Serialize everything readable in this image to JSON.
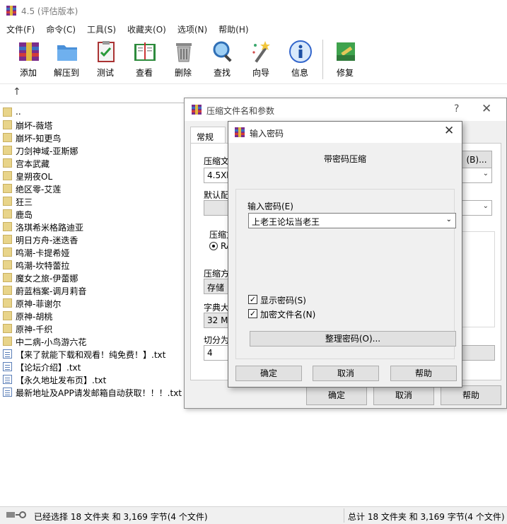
{
  "app": {
    "title": "4.5 (评估版本)"
  },
  "menu": [
    "文件(F)",
    "命令(C)",
    "工具(S)",
    "收藏夹(O)",
    "选项(N)",
    "帮助(H)"
  ],
  "toolbar": [
    {
      "label": "添加",
      "icon": "add-archive-icon"
    },
    {
      "label": "解压到",
      "icon": "extract-to-icon"
    },
    {
      "label": "测试",
      "icon": "test-icon"
    },
    {
      "label": "查看",
      "icon": "view-book-icon"
    },
    {
      "label": "删除",
      "icon": "delete-trash-icon"
    },
    {
      "label": "查找",
      "icon": "find-magnifier-icon"
    },
    {
      "label": "向导",
      "icon": "wizard-wand-icon"
    },
    {
      "label": "信息",
      "icon": "info-icon"
    },
    {
      "label": "修复",
      "icon": "repair-icon"
    }
  ],
  "address": {
    "up_symbol": "↑"
  },
  "files": [
    {
      "name": "..",
      "type": "folder"
    },
    {
      "name": "崩坏-薇塔",
      "type": "folder"
    },
    {
      "name": "崩坏-知更鸟",
      "type": "folder"
    },
    {
      "name": "刀剑神域-亚斯娜",
      "type": "folder"
    },
    {
      "name": "宫本武藏",
      "type": "folder"
    },
    {
      "name": "皇朔夜OL",
      "type": "folder"
    },
    {
      "name": "绝区零-艾莲",
      "type": "folder"
    },
    {
      "name": "狂三",
      "type": "folder"
    },
    {
      "name": "鹿岛",
      "type": "folder"
    },
    {
      "name": "洛琪希米格路迪亚",
      "type": "folder"
    },
    {
      "name": "明日方舟-迷迭香",
      "type": "folder"
    },
    {
      "name": "鸣潮-卡提希娅",
      "type": "folder"
    },
    {
      "name": "鸣潮-坎特蕾拉",
      "type": "folder"
    },
    {
      "name": "魔女之旅-伊蕾娜",
      "type": "folder"
    },
    {
      "name": "蔚蓝档案-调月莉音",
      "type": "folder"
    },
    {
      "name": "原神-菲谢尔",
      "type": "folder"
    },
    {
      "name": "原神-胡桃",
      "type": "folder"
    },
    {
      "name": "原神-千织",
      "type": "folder"
    },
    {
      "name": "中二病-小鸟游六花",
      "type": "folder"
    },
    {
      "name": "【来了就能下载和观看！纯免费！】.txt",
      "type": "txt"
    },
    {
      "name": "【论坛介绍】.txt",
      "type": "txt"
    },
    {
      "name": "【永久地址发布页】.txt",
      "type": "txt"
    },
    {
      "name": "最新地址及APP请发邮箱自动获取！！！.txt",
      "type": "txt"
    }
  ],
  "status": {
    "left": "已经选择 18 文件夹 和 3,169 字节(4 个文件)",
    "right": "总计 18 文件夹 和 3,169 字节(4 个文件)"
  },
  "back_dialog": {
    "title": "压缩文件名和参数",
    "help_symbol": "?",
    "close_symbol": "✕",
    "tab": "常规",
    "archive_name_label": "压缩文",
    "archive_name_value": "4.5Xbc",
    "browse_button": "(B)...",
    "default_profile_label": "默认配",
    "format_label": "压缩文",
    "format_option": "RA",
    "method_label": "压缩方",
    "method_value": "存储",
    "dict_label": "字典大",
    "dict_value": "32 MB",
    "split_label": "切分为",
    "split_value": "4",
    "ok_button": "确定",
    "cancel_button": "取消",
    "help_button": "帮助"
  },
  "front_dialog": {
    "title": "输入密码",
    "close_symbol": "✕",
    "heading": "带密码压缩",
    "password_label": "输入密码(E)",
    "password_value": "上老王论坛当老王",
    "show_password_label": "显示密码(S)",
    "show_password_checked": true,
    "encrypt_names_label": "加密文件名(N)",
    "encrypt_names_checked": true,
    "manage_button": "整理密码(O)...",
    "ok_button": "确定",
    "cancel_button": "取消",
    "help_button": "帮助"
  }
}
